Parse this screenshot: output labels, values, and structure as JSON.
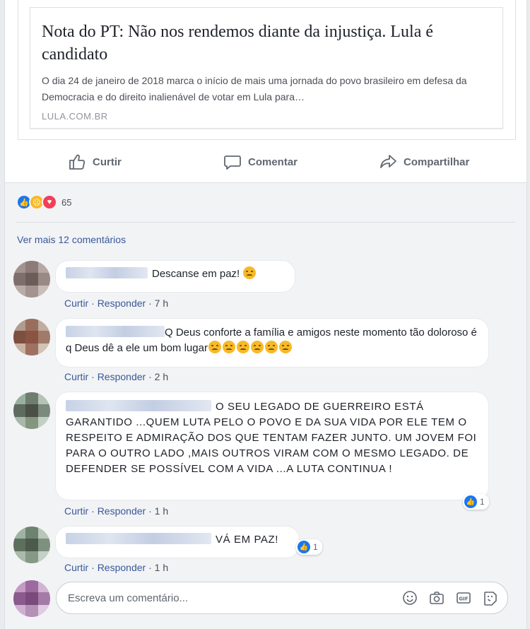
{
  "link_preview": {
    "title": "Nota do PT: Não nos rendemos diante da injustiça. Lula é candidato",
    "description": "O dia 24 de janeiro de 2018 marca o início de mais uma jornada do povo brasileiro em defesa da Democracia e do direito inalienável de votar em Lula para…",
    "domain": "LULA.COM.BR"
  },
  "actions": {
    "like": "Curtir",
    "comment": "Comentar",
    "share": "Compartilhar"
  },
  "reactions": {
    "types": [
      "like-icon",
      "sad-icon",
      "love-icon"
    ],
    "count": "65"
  },
  "view_more": "Ver mais 12 comentários",
  "comments": [
    {
      "text": "Descanse em paz! ",
      "emoji": [
        "sad-face-icon"
      ],
      "like": "Curtir",
      "reply": "Responder",
      "time": "7 h"
    },
    {
      "text": "Q Deus conforte a família e amigos neste momento tão doloroso é q Deus dê a ele um bom lugar",
      "emoji": [
        "weary-face-icon",
        "weary-face-icon",
        "weary-face-icon",
        "weary-face-icon",
        "weary-face-icon",
        "weary-face-icon"
      ],
      "like": "Curtir",
      "reply": "Responder",
      "time": "2 h"
    },
    {
      "text": "O SEU LEGADO DE GUERREIRO ESTÁ GARANTIDO ...QUEM LUTA PELO O POVO E DA SUA VIDA POR ELE TEM O RESPEITO E ADMIRAÇÃO DOS QUE TENTAM FAZER JUNTO. UM JOVEM FOI PARA O OUTRO LADO ,MAIS OUTROS VIRAM COM O MESMO LEGADO. DE DEFENDER SE POSSÍVEL COM A VIDA ...A LUTA CONTINUA !",
      "like": "Curtir",
      "reply": "Responder",
      "time": "1 h",
      "likes": "1"
    },
    {
      "text": "VÁ EM PAZ!",
      "like": "Curtir",
      "reply": "Responder",
      "time": "1 h",
      "likes": "1"
    }
  ],
  "composer": {
    "placeholder": "Escreva um comentário...",
    "icons": [
      "emoji-icon",
      "camera-icon",
      "gif-icon",
      "sticker-icon"
    ]
  },
  "colors": {
    "link_blue": "#385898",
    "like_blue": "#1877f2",
    "background": "#f2f3f5"
  }
}
